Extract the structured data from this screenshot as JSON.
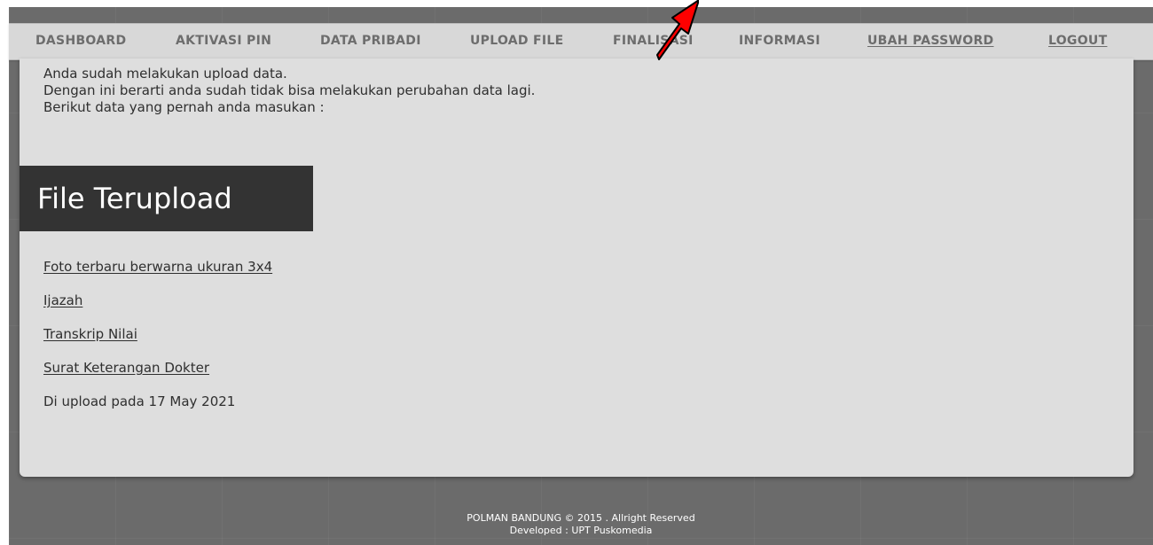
{
  "nav": {
    "dashboard": "DASHBOARD",
    "aktivasi_pin": "AKTIVASI PIN",
    "data_pribadi": "DATA PRIBADI",
    "upload_file": "UPLOAD FILE",
    "finalisasi": "FINALISASI",
    "informasi": "INFORMASI",
    "ubah_password": "UBAH PASSWORD",
    "logout": "LOGOUT"
  },
  "intro": {
    "line1": "Anda sudah melakukan upload data.",
    "line2": "Dengan ini berarti anda sudah tidak bisa melakukan perubahan data lagi.",
    "line3": "Berikut data yang pernah anda masukan :"
  },
  "section_title": "File Terupload",
  "files": [
    "Foto terbaru berwarna ukuran 3x4",
    "Ijazah",
    "Transkrip Nilai",
    "Surat Keterangan Dokter"
  ],
  "upload_date": "Di upload pada 17 May 2021",
  "footer": {
    "line1": "POLMAN BANDUNG © 2015 . Allright Reserved",
    "line2": "Developed : UPT Puskomedia"
  },
  "colors": {
    "nav_bg": "#d8d8d8",
    "nav_text": "#6d6d6d",
    "card_bg": "#dedede",
    "title_bg": "#333333",
    "page_bg": "#6b6b6b",
    "arrow": "#ff0000"
  },
  "annotation": {
    "icon": "red-arrow-pointer"
  }
}
